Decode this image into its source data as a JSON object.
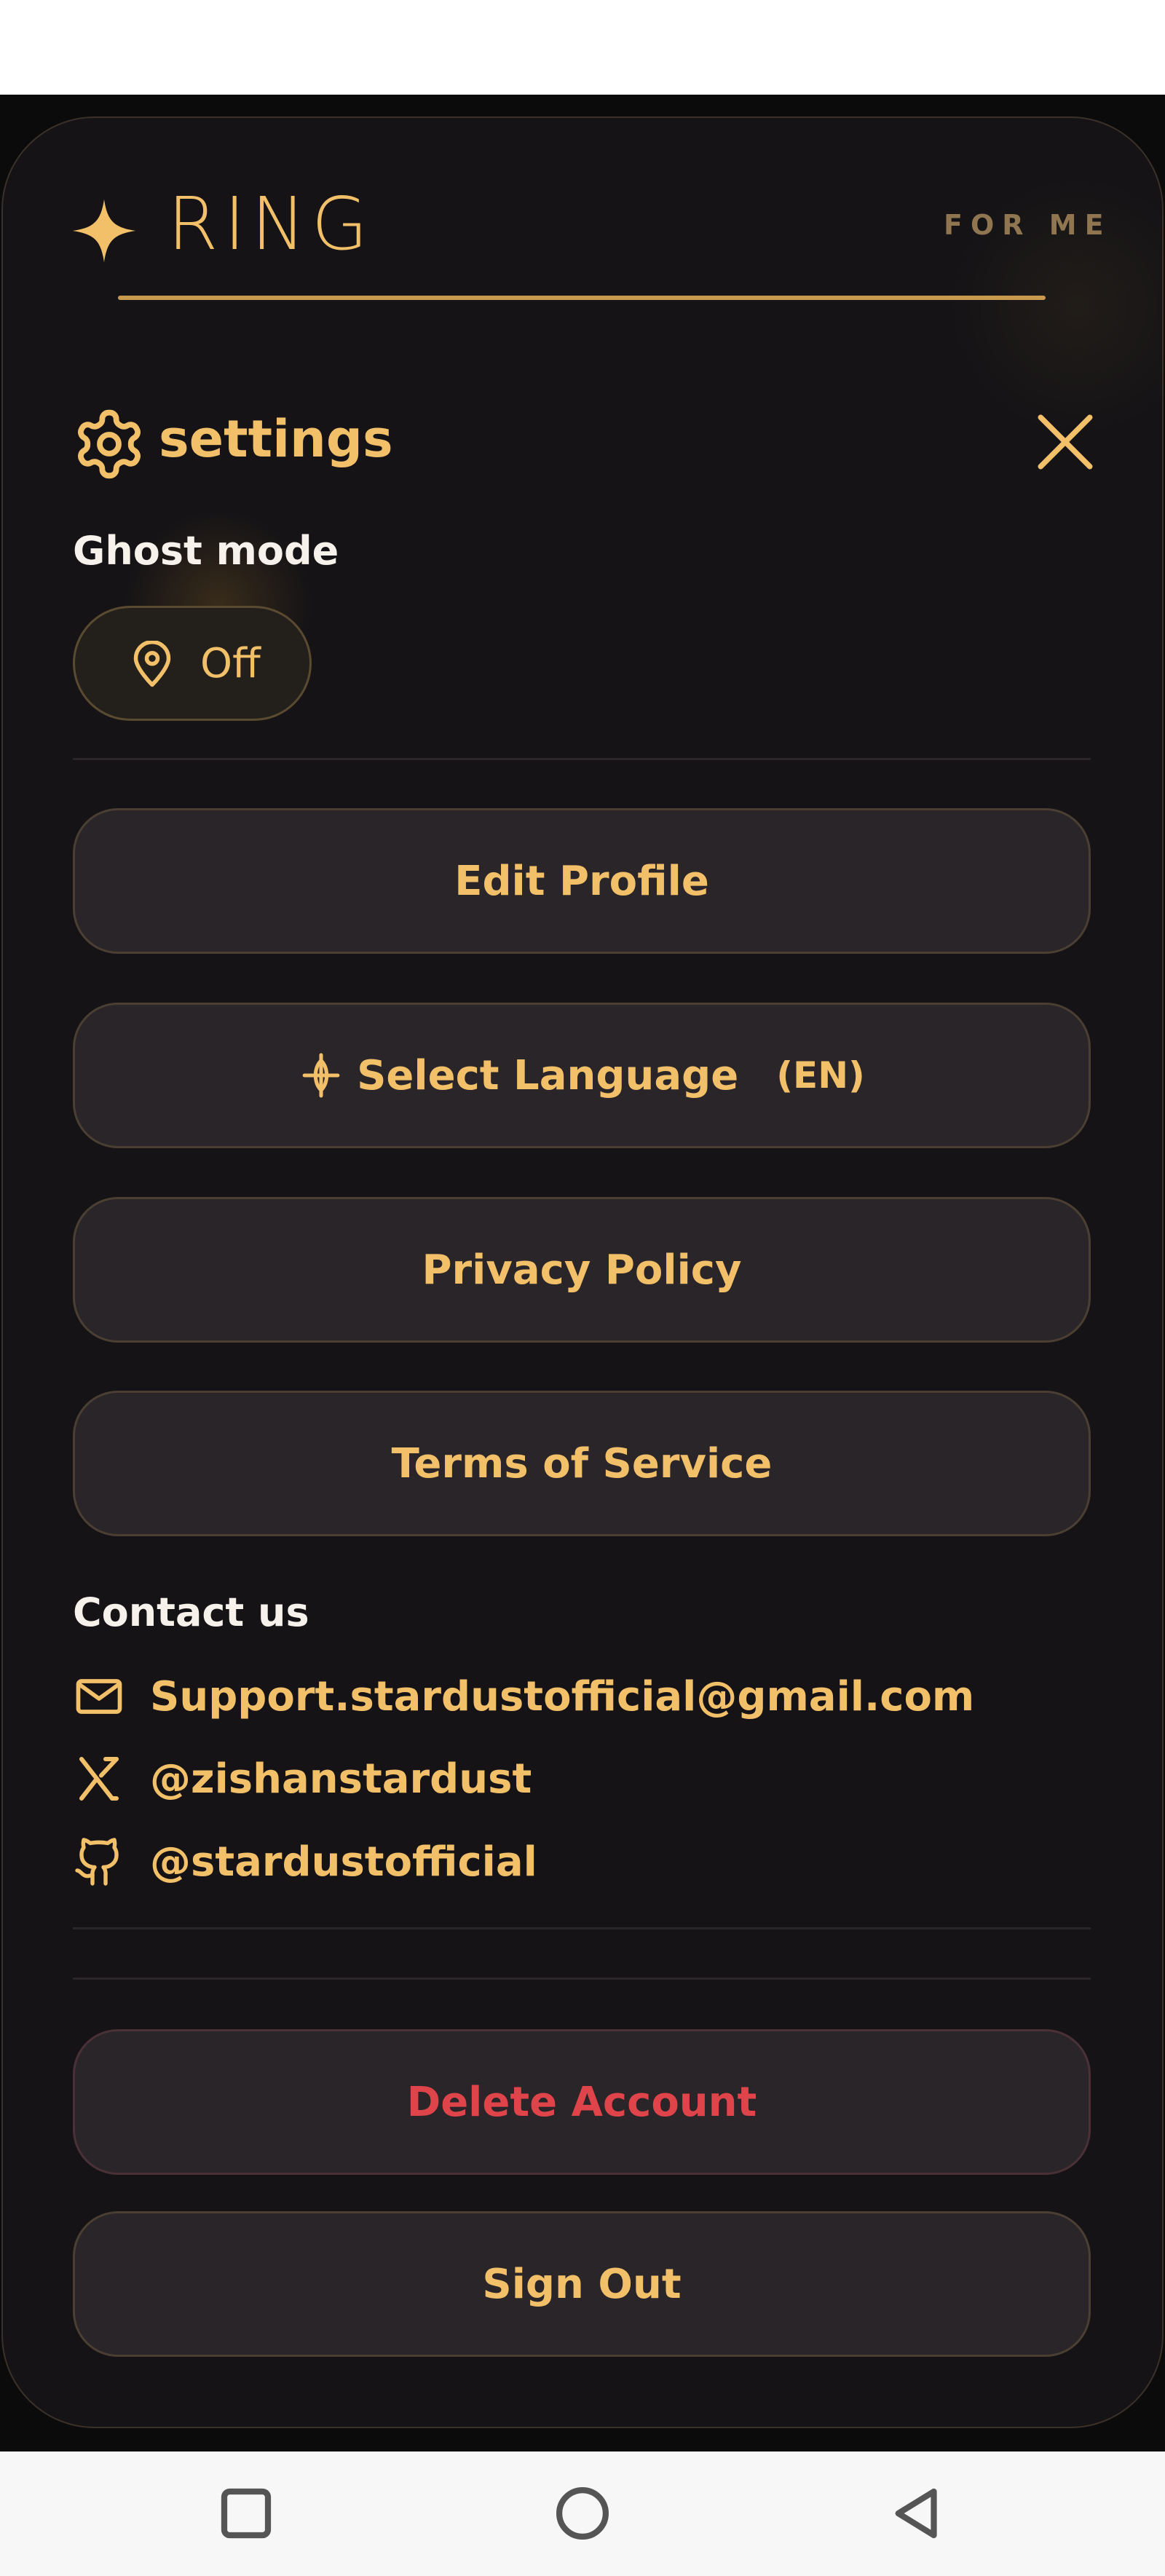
{
  "app": {
    "brand": "RING",
    "tagline": "FOR ME",
    "accent": "#f3c06a",
    "danger": "#e0444b",
    "background": "#151316"
  },
  "header": {
    "icon": "gear-icon",
    "title": "settings",
    "close_icon": "close-icon"
  },
  "ghost_mode": {
    "label": "Ghost mode",
    "value": "Off",
    "icon": "location-pin-icon"
  },
  "menu": {
    "edit_profile": "Edit Profile",
    "select_language": "Select Language",
    "language_code": "(EN)",
    "language_icon": "language-compass-icon",
    "privacy_policy": "Privacy Policy",
    "terms_of_service": "Terms of Service"
  },
  "contact": {
    "label": "Contact us",
    "items": [
      {
        "icon": "mail-icon",
        "text": "Support.stardustofficial@gmail.com"
      },
      {
        "icon": "x-twitter-icon",
        "text": "@zishanstardust"
      },
      {
        "icon": "github-icon",
        "text": "@stardustofficial"
      }
    ]
  },
  "account": {
    "delete": "Delete Account",
    "sign_out": "Sign Out"
  },
  "system_nav": {
    "recents": "recents-icon",
    "home": "home-icon",
    "back": "back-icon"
  }
}
